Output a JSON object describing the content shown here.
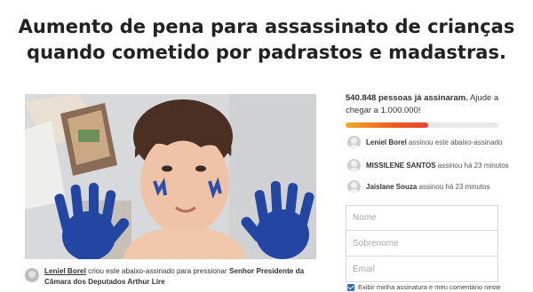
{
  "petition": {
    "title_line1": "Aumento de pena para assassinato de crianças",
    "title_line2": "quando cometido por padrastos e madastras."
  },
  "starter": {
    "name": "Leniel Borel",
    "text_after_name": " criou este abaixo-assinado para pressionar ",
    "target": "Senhor Presidente da Câmara dos Deputados Arthur Lire"
  },
  "signatures": {
    "count": "540.848",
    "count_suffix": " pessoas já assinaram.",
    "goal_text": " Ajude a chegar a 1.000.000!",
    "progress_fraction": 0.54
  },
  "recent_signers": [
    {
      "name": "Leniel Borel",
      "action": " assinou este abaixo-assinado"
    },
    {
      "name": "MISSILENE SANTOS",
      "action": " assinou há 23 minutos"
    },
    {
      "name": "Jaislane Souza",
      "action": " assinou há 23 minutos"
    }
  ],
  "form": {
    "first_name_placeholder": "Nome",
    "last_name_placeholder": "Sobrenome",
    "email_placeholder": "Email",
    "display_checkbox_label": "Exibir minha assinatura e meu comentário neste"
  },
  "colors": {
    "progress_start": "#f5a623",
    "progress_end": "#e8432e",
    "checkbox": "#2c6bd6"
  }
}
